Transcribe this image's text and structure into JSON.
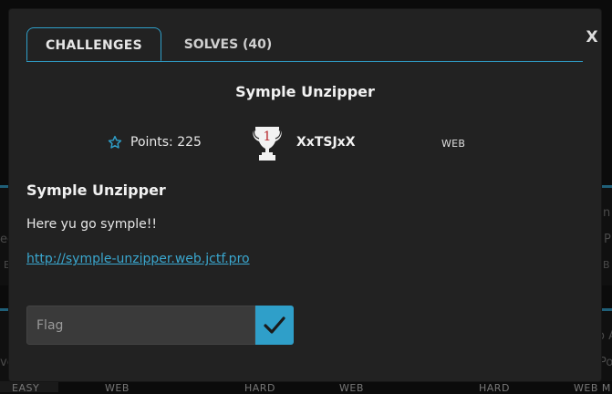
{
  "modal": {
    "close_label": "X",
    "tabs": [
      {
        "label": "CHALLENGES",
        "active": true
      },
      {
        "label": "SOLVES (40)",
        "active": false
      }
    ],
    "challenge": {
      "name": "Symple Unzipper",
      "points_label": "Points: 225",
      "author": "XxTSJxX",
      "category": "WEB",
      "description_title": "Symple Unzipper",
      "description_text": "Here yu go symple!!",
      "link": "http://symple-unzipper.web.jctf.pro"
    },
    "flag_form": {
      "placeholder": "Flag",
      "value": ""
    },
    "icons": {
      "star": "star-outline-icon",
      "trophy": "trophy-icon",
      "submit": "checkmark-icon"
    },
    "colors": {
      "accent": "#2f9fc9",
      "modal_bg": "#222222"
    }
  },
  "background": {
    "left_snippets": [
      "ed",
      "E"
    ],
    "right_snippets": [
      "n",
      "P",
      "B",
      "o A",
      "Po"
    ],
    "bottom_tags": [
      "EASY",
      "WEB",
      "HARD",
      "WEB",
      "HARD",
      "WEB M"
    ],
    "bottom_left_snippet": "ve"
  }
}
